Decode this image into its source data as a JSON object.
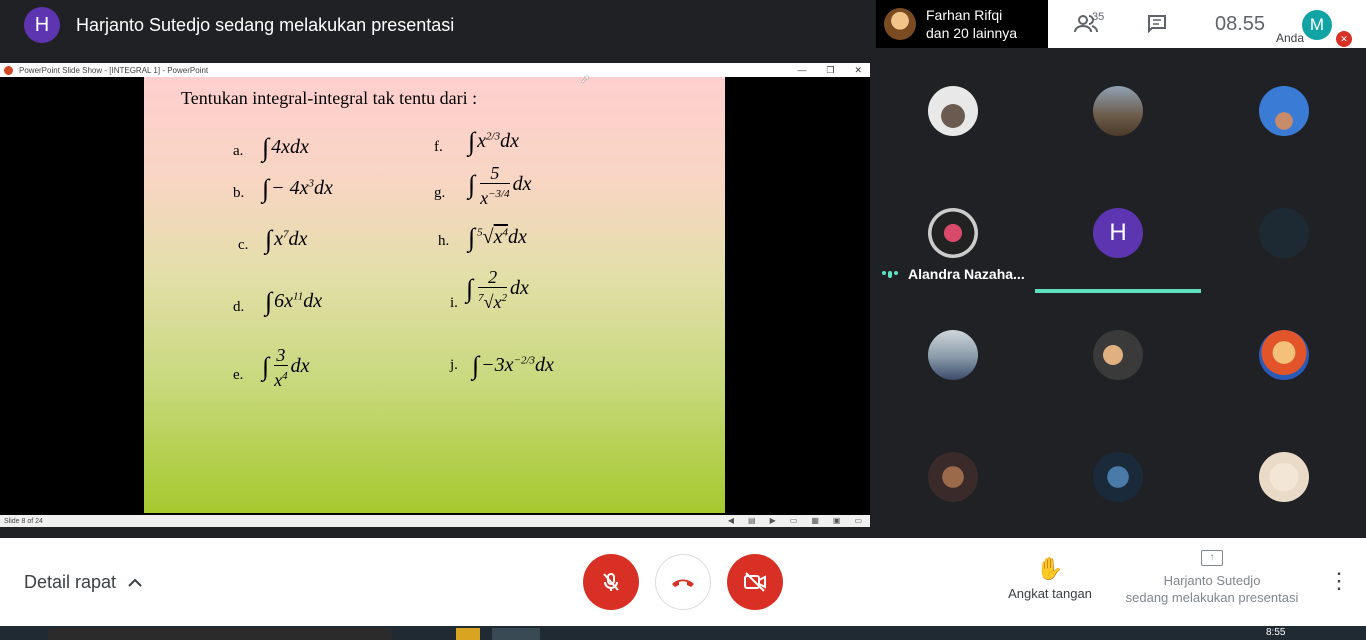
{
  "header": {
    "presenter_initial": "H",
    "presenting_text": "Harjanto Sutedjo sedang melakukan presentasi"
  },
  "presenter_chip": {
    "line1": "Farhan Rifqi",
    "line2": "dan 20 lainnya"
  },
  "top_right": {
    "people_count": "35",
    "time": "08.55",
    "self_initial": "M",
    "self_label": "Anda"
  },
  "powerpoint": {
    "window_title": "PowerPoint Slide Show - [INTEGRAL 1] - PowerPoint",
    "status": "Slide 8 of 24",
    "slide": {
      "heading": "Tentukan integral-integral tak tentu  dari :",
      "labels": [
        "a.",
        "b.",
        "c.",
        "d.",
        "e.",
        "f.",
        "g.",
        "h.",
        "i.",
        "j."
      ]
    }
  },
  "participants": {
    "speaking_name": "Alandra Nazaha...",
    "tile_initial": "H"
  },
  "bottom_bar": {
    "meeting_details": "Detail rapat",
    "raise_hand": "Angkat tangan",
    "presenting_line1": "Harjanto Sutedjo",
    "presenting_line2": "sedang melakukan presentasi"
  },
  "taskbar": {
    "clock": "8:55"
  },
  "colors": {
    "accent_red": "#d93025",
    "presenter_avatar": "#5e35b1",
    "speaking_green": "#5fe0c0"
  }
}
